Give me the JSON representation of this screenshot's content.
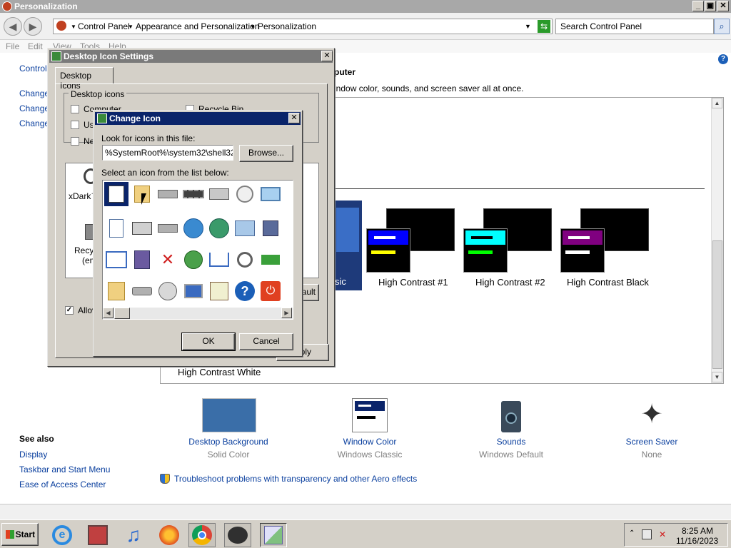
{
  "window": {
    "title": "Personalization"
  },
  "nav": {
    "breadcrumb": [
      "Control Panel",
      "Appearance and Personalization",
      "Personalization"
    ],
    "search_placeholder": "Search Control Panel"
  },
  "menu": [
    "File",
    "Edit",
    "View",
    "Tools",
    "Help"
  ],
  "left_links": [
    "Control",
    "Change",
    "Change",
    "Change"
  ],
  "heading": {
    "title": "puter",
    "subtitle": "indow color, sounds, and screen saver all at once."
  },
  "themes": [
    {
      "label": "sic"
    },
    {
      "label": "High Contrast #1",
      "bar_color": "#0000ff",
      "line_color": "#ffff00"
    },
    {
      "label": "High Contrast #2",
      "bar_color": "#00ffff",
      "line_color": "#00ff00"
    },
    {
      "label": "High Contrast Black",
      "bar_color": "#800080",
      "line_color": "#ffffff"
    },
    {
      "label": "High Contrast White"
    }
  ],
  "bottom_items": [
    {
      "label": "Desktop Background",
      "sub": "Solid Color"
    },
    {
      "label": "Window Color",
      "sub": "Windows Classic"
    },
    {
      "label": "Sounds",
      "sub": "Windows Default"
    },
    {
      "label": "Screen Saver",
      "sub": "None"
    }
  ],
  "see_also": {
    "title": "See also",
    "links": [
      "Display",
      "Taskbar and Start Menu",
      "Ease of Access Center"
    ]
  },
  "troubleshoot": "Troubleshoot problems with transparency and other Aero effects",
  "desktop_icon_dialog": {
    "title": "Desktop Icon Settings",
    "tab": "Desktop Icons",
    "group": "Desktop icons",
    "checkboxes": [
      "Computer",
      "Recycle Bin",
      "Us",
      "Ne"
    ],
    "preview_labels": [
      "xDark™",
      "Recyc",
      "(em"
    ],
    "allow_label": "Allov",
    "default_fragment": "ault",
    "apply_fragment": "ply"
  },
  "change_icon_dialog": {
    "title": "Change Icon",
    "look_label": "Look for icons in this file:",
    "path_value": "%SystemRoot%\\system32\\shell32.d",
    "browse": "Browse...",
    "list_label": "Select an icon from the list below:",
    "ok": "OK",
    "cancel": "Cancel"
  },
  "taskbar": {
    "start": "Start",
    "time": "8:25 AM",
    "date": "11/16/2023"
  },
  "colors": {
    "title_gray": "#a8a8a8",
    "dialog_title": "#0a246a",
    "link": "#0a3f9e",
    "face": "#d4d0c8"
  }
}
